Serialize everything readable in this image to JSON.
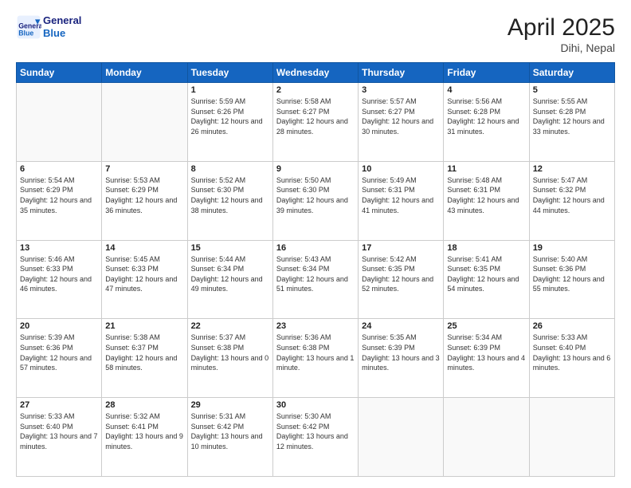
{
  "header": {
    "logo_line1": "General",
    "logo_line2": "Blue",
    "month_title": "April 2025",
    "location": "Dihi, Nepal"
  },
  "days_of_week": [
    "Sunday",
    "Monday",
    "Tuesday",
    "Wednesday",
    "Thursday",
    "Friday",
    "Saturday"
  ],
  "weeks": [
    [
      {
        "day": "",
        "info": ""
      },
      {
        "day": "",
        "info": ""
      },
      {
        "day": "1",
        "info": "Sunrise: 5:59 AM\nSunset: 6:26 PM\nDaylight: 12 hours and 26 minutes."
      },
      {
        "day": "2",
        "info": "Sunrise: 5:58 AM\nSunset: 6:27 PM\nDaylight: 12 hours and 28 minutes."
      },
      {
        "day": "3",
        "info": "Sunrise: 5:57 AM\nSunset: 6:27 PM\nDaylight: 12 hours and 30 minutes."
      },
      {
        "day": "4",
        "info": "Sunrise: 5:56 AM\nSunset: 6:28 PM\nDaylight: 12 hours and 31 minutes."
      },
      {
        "day": "5",
        "info": "Sunrise: 5:55 AM\nSunset: 6:28 PM\nDaylight: 12 hours and 33 minutes."
      }
    ],
    [
      {
        "day": "6",
        "info": "Sunrise: 5:54 AM\nSunset: 6:29 PM\nDaylight: 12 hours and 35 minutes."
      },
      {
        "day": "7",
        "info": "Sunrise: 5:53 AM\nSunset: 6:29 PM\nDaylight: 12 hours and 36 minutes."
      },
      {
        "day": "8",
        "info": "Sunrise: 5:52 AM\nSunset: 6:30 PM\nDaylight: 12 hours and 38 minutes."
      },
      {
        "day": "9",
        "info": "Sunrise: 5:50 AM\nSunset: 6:30 PM\nDaylight: 12 hours and 39 minutes."
      },
      {
        "day": "10",
        "info": "Sunrise: 5:49 AM\nSunset: 6:31 PM\nDaylight: 12 hours and 41 minutes."
      },
      {
        "day": "11",
        "info": "Sunrise: 5:48 AM\nSunset: 6:31 PM\nDaylight: 12 hours and 43 minutes."
      },
      {
        "day": "12",
        "info": "Sunrise: 5:47 AM\nSunset: 6:32 PM\nDaylight: 12 hours and 44 minutes."
      }
    ],
    [
      {
        "day": "13",
        "info": "Sunrise: 5:46 AM\nSunset: 6:33 PM\nDaylight: 12 hours and 46 minutes."
      },
      {
        "day": "14",
        "info": "Sunrise: 5:45 AM\nSunset: 6:33 PM\nDaylight: 12 hours and 47 minutes."
      },
      {
        "day": "15",
        "info": "Sunrise: 5:44 AM\nSunset: 6:34 PM\nDaylight: 12 hours and 49 minutes."
      },
      {
        "day": "16",
        "info": "Sunrise: 5:43 AM\nSunset: 6:34 PM\nDaylight: 12 hours and 51 minutes."
      },
      {
        "day": "17",
        "info": "Sunrise: 5:42 AM\nSunset: 6:35 PM\nDaylight: 12 hours and 52 minutes."
      },
      {
        "day": "18",
        "info": "Sunrise: 5:41 AM\nSunset: 6:35 PM\nDaylight: 12 hours and 54 minutes."
      },
      {
        "day": "19",
        "info": "Sunrise: 5:40 AM\nSunset: 6:36 PM\nDaylight: 12 hours and 55 minutes."
      }
    ],
    [
      {
        "day": "20",
        "info": "Sunrise: 5:39 AM\nSunset: 6:36 PM\nDaylight: 12 hours and 57 minutes."
      },
      {
        "day": "21",
        "info": "Sunrise: 5:38 AM\nSunset: 6:37 PM\nDaylight: 12 hours and 58 minutes."
      },
      {
        "day": "22",
        "info": "Sunrise: 5:37 AM\nSunset: 6:38 PM\nDaylight: 13 hours and 0 minutes."
      },
      {
        "day": "23",
        "info": "Sunrise: 5:36 AM\nSunset: 6:38 PM\nDaylight: 13 hours and 1 minute."
      },
      {
        "day": "24",
        "info": "Sunrise: 5:35 AM\nSunset: 6:39 PM\nDaylight: 13 hours and 3 minutes."
      },
      {
        "day": "25",
        "info": "Sunrise: 5:34 AM\nSunset: 6:39 PM\nDaylight: 13 hours and 4 minutes."
      },
      {
        "day": "26",
        "info": "Sunrise: 5:33 AM\nSunset: 6:40 PM\nDaylight: 13 hours and 6 minutes."
      }
    ],
    [
      {
        "day": "27",
        "info": "Sunrise: 5:33 AM\nSunset: 6:40 PM\nDaylight: 13 hours and 7 minutes."
      },
      {
        "day": "28",
        "info": "Sunrise: 5:32 AM\nSunset: 6:41 PM\nDaylight: 13 hours and 9 minutes."
      },
      {
        "day": "29",
        "info": "Sunrise: 5:31 AM\nSunset: 6:42 PM\nDaylight: 13 hours and 10 minutes."
      },
      {
        "day": "30",
        "info": "Sunrise: 5:30 AM\nSunset: 6:42 PM\nDaylight: 13 hours and 12 minutes."
      },
      {
        "day": "",
        "info": ""
      },
      {
        "day": "",
        "info": ""
      },
      {
        "day": "",
        "info": ""
      }
    ]
  ]
}
